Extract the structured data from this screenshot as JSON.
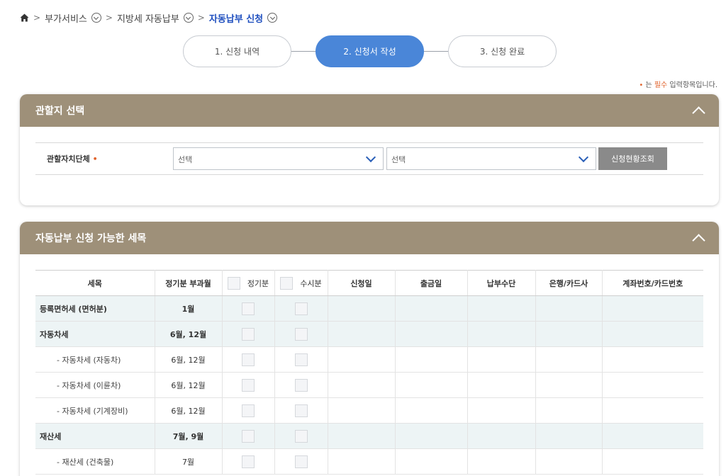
{
  "breadcrumb": {
    "home_icon": "home-icon",
    "items": [
      "부가서비스",
      "지방세 자동납부",
      "자동납부 신청"
    ]
  },
  "steps": [
    "1. 신청 내역",
    "2. 신청서 작성",
    "3. 신청 완료"
  ],
  "active_step": 2,
  "required_note": {
    "mark": "•",
    "prefix": " 는 ",
    "emphasis": "필수",
    "suffix": " 입력항목입니다."
  },
  "region_panel": {
    "title": "관할지 선택",
    "label": "관할자치단체",
    "required_mark": "•",
    "select1": "선택",
    "select2": "선택",
    "button": "신청현황조회"
  },
  "tax_panel": {
    "title": "자동납부 신청 가능한 세목",
    "columns": [
      "세목",
      "정기분 부과월",
      "정기분",
      "수시분",
      "신청일",
      "출금일",
      "납부수단",
      "은행/카드사",
      "계좌번호/카드번호"
    ],
    "rows": [
      {
        "name": "등록면허세 (면허분)",
        "months": "1월",
        "group": true
      },
      {
        "name": "자동차세",
        "months": "6월, 12월",
        "group": true
      },
      {
        "name": "- 자동차세 (자동차)",
        "months": "6월, 12월",
        "group": false
      },
      {
        "name": "- 자동차세 (이륜차)",
        "months": "6월, 12월",
        "group": false
      },
      {
        "name": "- 자동차세 (기계장비)",
        "months": "6월, 12월",
        "group": false
      },
      {
        "name": "재산세",
        "months": "7월, 9월",
        "group": true
      },
      {
        "name": "- 재산세 (건축물)",
        "months": "7월",
        "group": false
      }
    ]
  },
  "colors": {
    "panel_header": "#9e9079",
    "active_step": "#4a86d8",
    "breadcrumb_current": "#1f4fbf",
    "required": "#e0622b",
    "group_row": "#edf4f5"
  }
}
